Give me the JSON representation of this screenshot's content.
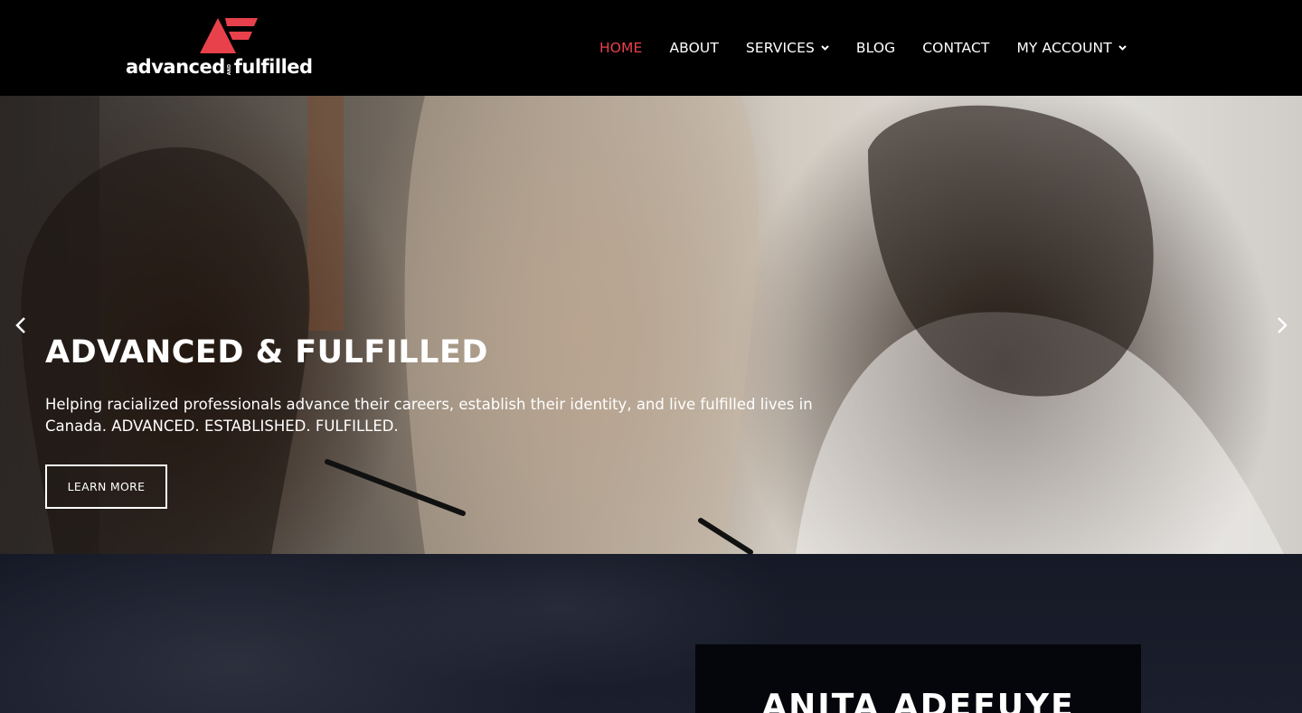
{
  "header": {
    "logo_text_left": "advanced",
    "logo_text_and": "AND",
    "logo_text_right": "fulfilled",
    "nav": [
      {
        "label": "HOME",
        "active": true
      },
      {
        "label": "ABOUT",
        "active": false
      },
      {
        "label": "SERVICES",
        "active": false,
        "dropdown": true
      },
      {
        "label": "BLOG",
        "active": false
      },
      {
        "label": "CONTACT",
        "active": false
      },
      {
        "label": "MY ACCOUNT",
        "active": false,
        "dropdown": true
      }
    ]
  },
  "hero": {
    "title": "ADVANCED & FULFILLED",
    "subtitle": "Helping racialized professionals advance their careers, establish their identity, and live fulfilled lives in Canada. ADVANCED. ESTABLISHED. FULFILLED.",
    "button_label": "LEARN MORE",
    "prev_icon": "chevron-left-icon",
    "next_icon": "chevron-right-icon"
  },
  "profile": {
    "name": "ANITA ADEFUYE"
  },
  "colors": {
    "brand_red": "#e8414b",
    "header_bg": "#000000",
    "lower_bg": "#1b1f2d"
  }
}
